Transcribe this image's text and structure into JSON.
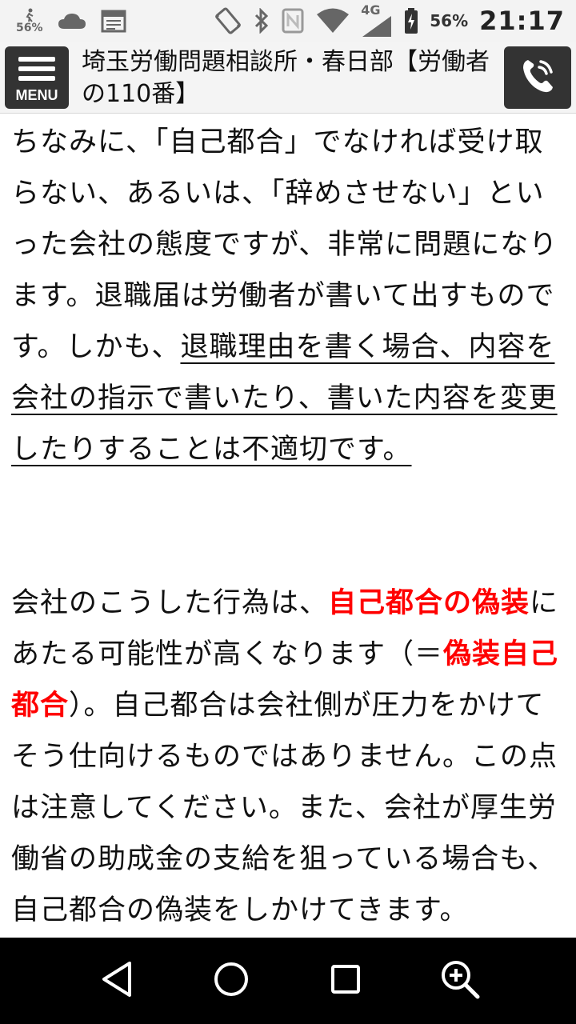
{
  "status_bar": {
    "left_percent": "56%",
    "battery_percent": "56%",
    "network": "4G",
    "time": "21:17",
    "icons": [
      "walking-icon",
      "cloud-icon",
      "calendar-icon",
      "vibrate-icon",
      "bluetooth-icon",
      "nfc-icon",
      "wifi-icon",
      "signal-icon",
      "battery-icon"
    ]
  },
  "header": {
    "menu_label": "MENU",
    "title": "埼玉労働問題相談所・春日部【労働者の110番】",
    "call_icon": "phone-icon"
  },
  "article": {
    "p1_plain": "ちなみに、「自己都合」でなければ受け取らない、あるいは、「辞めさせない」といった会社の態度ですが、非常に問題になります。退職届は労働者が書いて出すものです。しかも、",
    "p1_underlined": "退職理由を書く場合、内容を会社の指示で書いたり、書いた内容を変更したりすることは不適切です。",
    "p2_a": "会社のこうした行為は、",
    "p2_red1": "自己都合の偽装",
    "p2_b": "にあたる可能性が高くなります（＝",
    "p2_red2": "偽装自己都合",
    "p2_c": "）。自己都合は会社側が圧力をかけてそう仕向けるものではありません。この点は注意してください。また、会社が厚生労働省の助成金の支給を狙っている場合も、自己都合の偽装をしかけてきます。"
  },
  "nav_bar": {
    "buttons": [
      "back-icon",
      "home-icon",
      "recents-icon",
      "zoom-in-icon"
    ]
  },
  "colors": {
    "highlight_red": "#ff0000",
    "header_button": "#333333",
    "nav_bar": "#000000"
  }
}
